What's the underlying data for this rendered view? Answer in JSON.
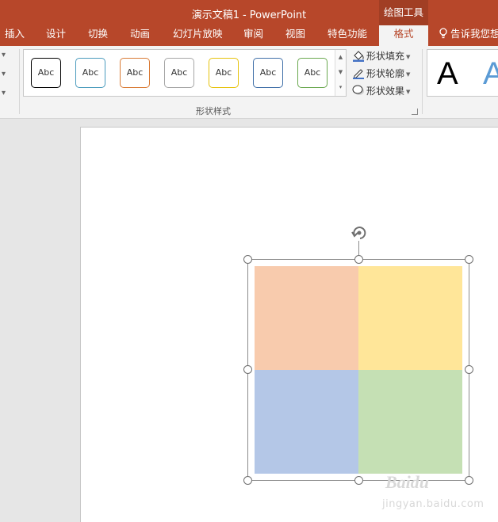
{
  "app": {
    "doc_title": "演示文稿1",
    "separator": "-",
    "app_name": "PowerPoint",
    "context_group": "绘图工具"
  },
  "tabs": [
    {
      "label": "插入"
    },
    {
      "label": "设计"
    },
    {
      "label": "切换"
    },
    {
      "label": "动画"
    },
    {
      "label": "幻灯片放映"
    },
    {
      "label": "审阅"
    },
    {
      "label": "视图"
    },
    {
      "label": "特色功能"
    },
    {
      "label": "格式",
      "active": true
    }
  ],
  "tell_me": {
    "label": "告诉我您想",
    "icon": "lightbulb-icon"
  },
  "ribbon": {
    "shape_styles": {
      "group_label": "形状样式",
      "items": [
        {
          "label": "Abc",
          "border_color": "#000000"
        },
        {
          "label": "Abc",
          "border_color": "#4a9bbd"
        },
        {
          "label": "Abc",
          "border_color": "#d97a34"
        },
        {
          "label": "Abc",
          "border_color": "#a5a5a5"
        },
        {
          "label": "Abc",
          "border_color": "#e6c20a"
        },
        {
          "label": "Abc",
          "border_color": "#3f6fa8"
        },
        {
          "label": "Abc",
          "border_color": "#6aa84f"
        }
      ]
    },
    "commands": {
      "fill": {
        "label": "形状填充",
        "icon": "paint-bucket-icon"
      },
      "outline": {
        "label": "形状轮廓",
        "icon": "pencil-outline-icon"
      },
      "effects": {
        "label": "形状效果",
        "icon": "effects-icon"
      }
    },
    "wordart": {
      "items": [
        {
          "label": "A",
          "color": "#000000"
        },
        {
          "label": "A",
          "color": "#5b9bd5"
        }
      ]
    }
  },
  "slide": {
    "quadrants": [
      {
        "name": "top-left",
        "color": "#f8cbad"
      },
      {
        "name": "top-right",
        "color": "#ffe699"
      },
      {
        "name": "bottom-left",
        "color": "#b4c7e7"
      },
      {
        "name": "bottom-right",
        "color": "#c5e0b4"
      }
    ]
  },
  "watermark": {
    "top": "Baidu",
    "bottom": "jingyan.baidu.com"
  },
  "colors": {
    "accent": "#b7472a",
    "accent_dark": "#a13e24"
  }
}
